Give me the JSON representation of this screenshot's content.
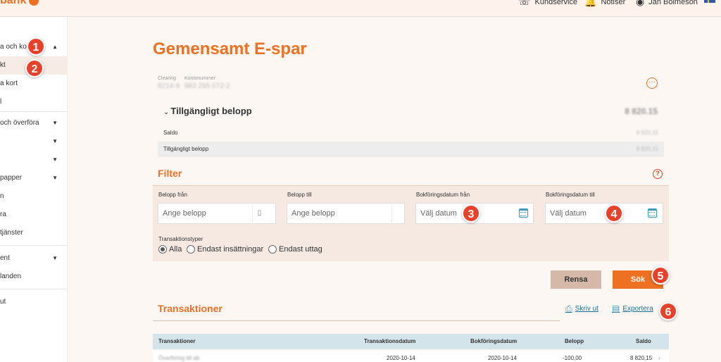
{
  "topbar": {
    "logo": "bank",
    "kundservice": "Kundservice",
    "notiser": "Notiser",
    "user": "Jan Bolmeson"
  },
  "sidebar": {
    "items": [
      {
        "label": "a och kort"
      },
      {
        "label": "kt"
      },
      {
        "label": "a kort"
      },
      {
        "label": "l"
      },
      {
        "label": "och överföra"
      },
      {
        "label": ""
      },
      {
        "label": ""
      },
      {
        "label": "papper"
      },
      {
        "label": "n"
      },
      {
        "label": "ra"
      },
      {
        "label": "tjänster"
      },
      {
        "label": "ent"
      },
      {
        "label": "landen"
      },
      {
        "label": "ut"
      }
    ]
  },
  "badges": [
    "1",
    "2",
    "3",
    "4",
    "5",
    "6"
  ],
  "account": {
    "title": "Gemensamt E-spar",
    "clearing_label": "Clearing",
    "clearing_value": "8214-9",
    "account_label": "Kontonummer",
    "account_value": "983 295 072-2",
    "more_symbol": "···"
  },
  "available": {
    "heading": "Tillgängligt belopp",
    "toggle": "⌄",
    "amount": "8 820.15",
    "rows": [
      {
        "label": "Saldo",
        "amount": "8 820.15"
      },
      {
        "label": "Tillgängligt belopp",
        "amount": "8 820.15"
      }
    ]
  },
  "filter": {
    "title": "Filter",
    "help": "?",
    "amount_from_label": "Belopp från",
    "amount_from_placeholder": "Ange belopp",
    "amount_to_label": "Belopp till",
    "amount_to_placeholder": "Ange belopp",
    "date_from_label": "Bokföringsdatum från",
    "date_from_placeholder": "Välj datum",
    "date_to_label": "Bokföringsdatum till",
    "date_to_placeholder": "Välj datum",
    "types_label": "Transaktionstyper",
    "types": [
      {
        "label": "Alla",
        "selected": true
      },
      {
        "label": "Endast insättningar",
        "selected": false
      },
      {
        "label": "Endast uttag",
        "selected": false
      }
    ],
    "clear_label": "Rensa",
    "search_label": "Sök"
  },
  "transactions": {
    "title": "Transaktioner",
    "print_label": "Skriv ut",
    "export_label": "Exportera",
    "columns": [
      "Transaktioner",
      "Transaktionsdatum",
      "Bokföringsdatum",
      "Belopp",
      "Saldo"
    ],
    "rows": [
      {
        "text": "Överföring till ab",
        "tdate": "2020-10-14",
        "bdate": "2020-10-14",
        "amount": "-100,00",
        "balance": "8 820,15"
      }
    ]
  },
  "colors": {
    "brand": "#ee7023",
    "badge": "#e8412b",
    "link": "#1e6f8f",
    "filter_bg": "#f6e9e1",
    "table_head": "#d4e4eb"
  }
}
